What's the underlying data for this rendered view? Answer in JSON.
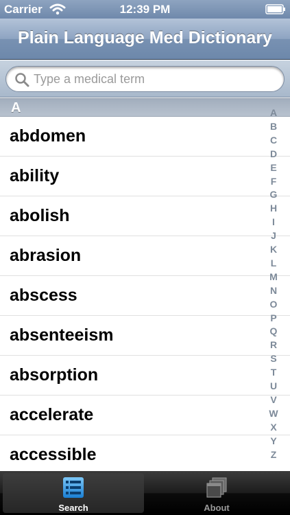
{
  "status_bar": {
    "carrier": "Carrier",
    "time": "12:39 PM",
    "wifi_icon": "wifi-icon",
    "battery_icon": "battery-icon"
  },
  "nav": {
    "title": "Plain Language Med Dictionary"
  },
  "search": {
    "placeholder": "Type a medical term",
    "value": "",
    "icon": "search-icon"
  },
  "section": {
    "header": "A"
  },
  "terms": [
    "abdomen",
    "ability",
    "abolish",
    "abrasion",
    "abscess",
    "absenteeism",
    "absorption",
    "accelerate",
    "accessible"
  ],
  "index_letters": [
    "A",
    "B",
    "C",
    "D",
    "E",
    "F",
    "G",
    "H",
    "I",
    "J",
    "K",
    "L",
    "M",
    "N",
    "O",
    "P",
    "Q",
    "R",
    "S",
    "T",
    "U",
    "V",
    "W",
    "X",
    "Y",
    "Z"
  ],
  "tabs": [
    {
      "label": "Search",
      "icon": "search-list-icon",
      "selected": true
    },
    {
      "label": "About",
      "icon": "windows-stack-icon",
      "selected": false
    }
  ],
  "colors": {
    "nav_bar": "#7891b2",
    "index_text": "#7d8a99",
    "tab_selected_icon": "#3a9ee8"
  }
}
